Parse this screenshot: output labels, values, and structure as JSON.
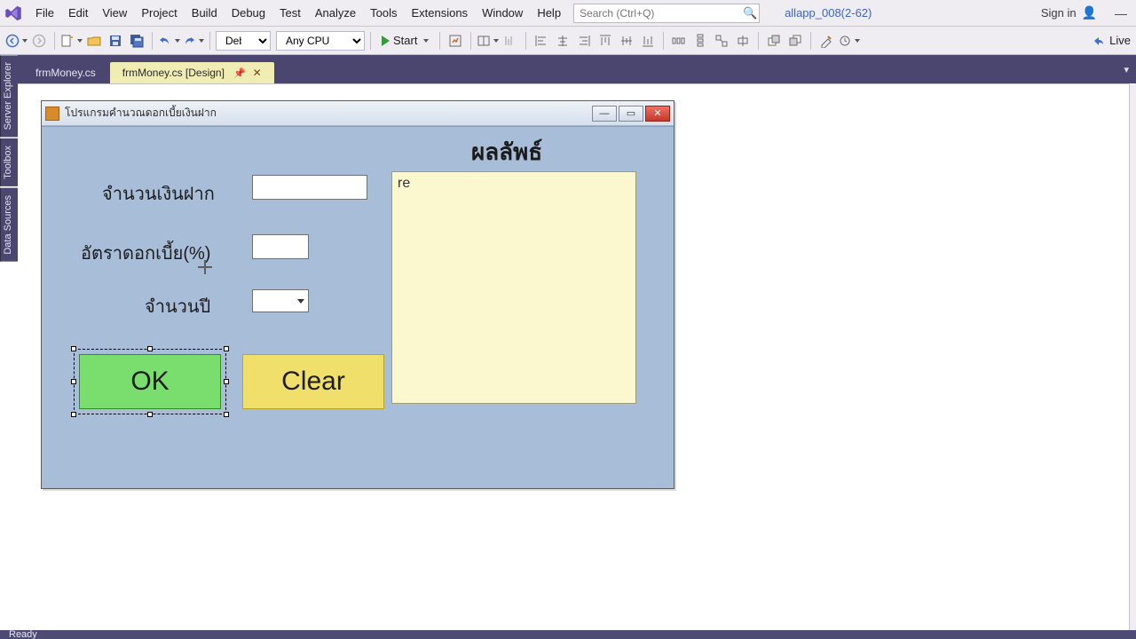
{
  "menu": {
    "items": [
      "File",
      "Edit",
      "View",
      "Project",
      "Build",
      "Debug",
      "Test",
      "Analyze",
      "Tools",
      "Extensions",
      "Window",
      "Help"
    ]
  },
  "search": {
    "placeholder": "Search (Ctrl+Q)"
  },
  "app_title": "allapp_008(2-62)",
  "signin": {
    "label": "Sign in"
  },
  "toolbar": {
    "configuration": "Debug",
    "platform": "Any CPU",
    "start_label": "Start",
    "live_label": "Live"
  },
  "sidetabs": [
    "Server Explorer",
    "Toolbox",
    "Data Sources"
  ],
  "tabs": [
    {
      "label": "frmMoney.cs",
      "active": false
    },
    {
      "label": "frmMoney.cs [Design]",
      "active": true
    }
  ],
  "form": {
    "title": "โปรแกรมคำนวณดอกเบี้ยเงินฝาก",
    "result_heading": "ผลลัพธ์",
    "labels": {
      "deposit": "จำนวนเงินฝาก",
      "rate": "อัตราดอกเบี้ย(%)",
      "years": "จำนวนปี"
    },
    "inputs": {
      "deposit": "",
      "rate": "",
      "years": ""
    },
    "buttons": {
      "ok": "OK",
      "clear": "Clear"
    },
    "result_text": "re"
  },
  "status": {
    "text": "Ready"
  }
}
